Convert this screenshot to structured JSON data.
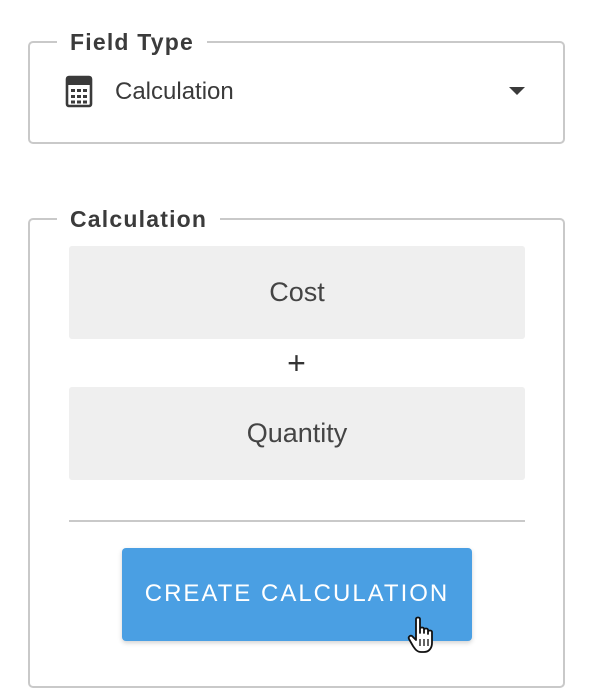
{
  "field_type": {
    "legend": "Field Type",
    "selected_value": "Calculation",
    "icon": "calculator-icon",
    "dropdown_icon": "chevron-down-icon"
  },
  "calculation": {
    "legend": "Calculation",
    "operand_1": "Cost",
    "operator": "+",
    "operand_2": "Quantity",
    "create_button_label": "CREATE CALCULATION",
    "button_color": "#4a9fe3"
  },
  "cursor": {
    "icon": "hand-pointer-icon"
  }
}
